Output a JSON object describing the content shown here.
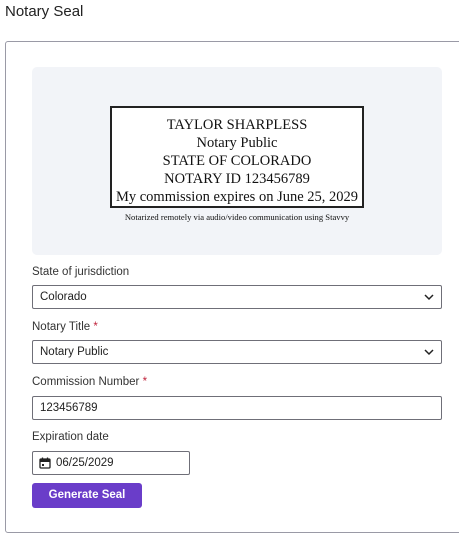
{
  "page": {
    "title": "Notary Seal"
  },
  "seal": {
    "lines": [
      "TAYLOR SHARPLESS",
      "Notary Public",
      "STATE OF COLORADO",
      "NOTARY ID 123456789",
      "My commission expires on June 25, 2029"
    ],
    "note": "Notarized remotely via audio/video communication using Stavvy"
  },
  "form": {
    "state": {
      "label": "State of jurisdiction",
      "value": "Colorado"
    },
    "title": {
      "label": "Notary Title",
      "required_mark": "*",
      "value": "Notary Public"
    },
    "commission": {
      "label": "Commission Number",
      "required_mark": "*",
      "value": "123456789"
    },
    "expiration": {
      "label": "Expiration date",
      "value": "06/25/2029"
    },
    "submit_label": "Generate Seal"
  },
  "icons": {
    "dropdown": "chevron-down-icon",
    "date": "calendar-icon"
  },
  "colors": {
    "accent": "#6a3dc9",
    "required": "#c0243c",
    "preview_bg": "#f2f4f8"
  }
}
